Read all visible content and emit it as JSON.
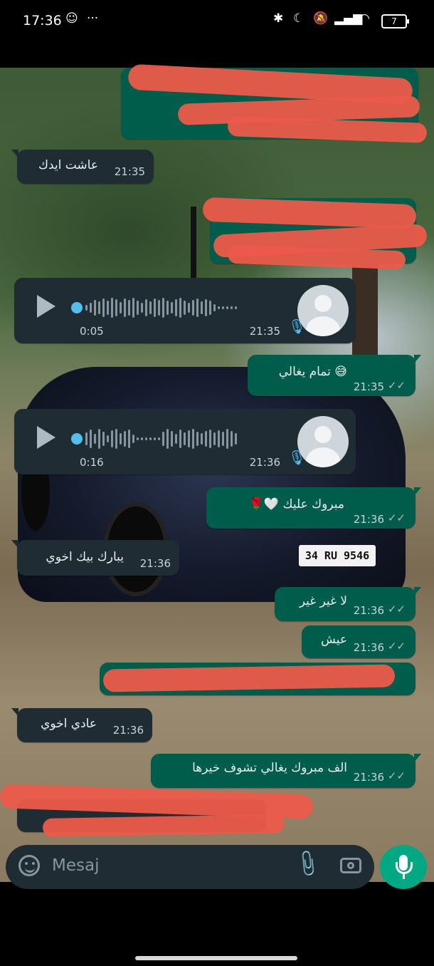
{
  "status_bar": {
    "time": "17:36",
    "battery": "7"
  },
  "messages": [
    {
      "dir": "in",
      "text": "عاشت ايدك",
      "time": "21:35"
    },
    {
      "dir": "in",
      "type": "voice",
      "duration": "0:05",
      "time": "21:35"
    },
    {
      "dir": "out",
      "text": "تمام يغالي",
      "emoji": "😅",
      "time": "21:35"
    },
    {
      "dir": "in",
      "type": "voice",
      "duration": "0:16",
      "time": "21:36"
    },
    {
      "dir": "out",
      "text": "مبروك عليك",
      "emoji": "🌹🤍",
      "time": "21:36"
    },
    {
      "dir": "in",
      "text": "يبارك بيك اخوي",
      "time": "21:36"
    },
    {
      "dir": "out",
      "text": "لا غير غير",
      "time": "21:36"
    },
    {
      "dir": "out",
      "text": "عيش",
      "time": "21:36"
    },
    {
      "dir": "in",
      "text": "عادي اخوي",
      "time": "21:36"
    },
    {
      "dir": "out",
      "text": "الف مبروك يغالي تشوف خيرها",
      "time": "21:36"
    }
  ],
  "background": {
    "plate": "34 RU 9546"
  },
  "input": {
    "placeholder": "Mesaj"
  },
  "colors": {
    "incoming": "#1f2c34",
    "outgoing": "#005c4b",
    "accent": "#00a884",
    "redaction": "#ec5a4a"
  }
}
